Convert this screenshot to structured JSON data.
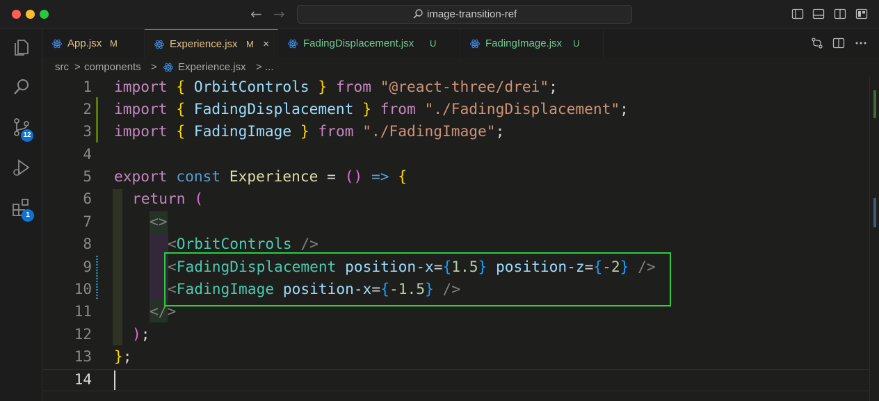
{
  "titlebar": {
    "search_text": "image-transition-ref"
  },
  "activity": {
    "source_control_badge": "12",
    "extensions_badge": "1"
  },
  "tabs": [
    {
      "label": "App.jsx",
      "status": "M",
      "color": "#e2c08d"
    },
    {
      "label": "Experience.jsx",
      "status": "M",
      "color": "#e2c08d"
    },
    {
      "label": "FadingDisplacement.jsx",
      "status": "U",
      "color": "#73c991"
    },
    {
      "label": "FadingImage.jsx",
      "status": "U",
      "color": "#73c991"
    }
  ],
  "close_glyph": "×",
  "breadcrumb": {
    "seg1": "src",
    "seg2": "components",
    "seg3": "Experience.jsx",
    "seg4": "...",
    "sep": ">"
  },
  "line_numbers": [
    "1",
    "2",
    "3",
    "4",
    "5",
    "6",
    "7",
    "8",
    "9",
    "10",
    "11",
    "12",
    "13",
    "14"
  ],
  "code": {
    "l1": {
      "t1": "import",
      "t2": " ",
      "t3": "{",
      "t4": " OrbitControls ",
      "t5": "}",
      "t6": " from ",
      "t7": "\"@react-three/drei\"",
      "t8": ";"
    },
    "l2": {
      "t1": "import",
      "t2": " ",
      "t3": "{",
      "t4": " FadingDisplacement ",
      "t5": "}",
      "t6": " from ",
      "t7": "\"./FadingDisplacement\"",
      "t8": ";"
    },
    "l3": {
      "t1": "import",
      "t2": " ",
      "t3": "{",
      "t4": " FadingImage ",
      "t5": "}",
      "t6": " from ",
      "t7": "\"./FadingImage\"",
      "t8": ";"
    },
    "l5": {
      "t1": "export",
      "t2": " ",
      "t3": "const",
      "t4": " ",
      "t5": "Experience",
      "t6": " = ",
      "t7": "()",
      "t8": " ",
      "t9": "=>",
      "t10": " ",
      "t11": "{"
    },
    "l6": {
      "t1": "return",
      "t2": " ",
      "t3": "("
    },
    "l7": {
      "t1": "<>"
    },
    "l8": {
      "t1": "<",
      "t2": "OrbitControls",
      "t3": " />"
    },
    "l9": {
      "t1": "<",
      "t2": "FadingDisplacement",
      "t3": " ",
      "t4": "position-x",
      "t5": "=",
      "t6": "{",
      "t7": "1.5",
      "t8": "}",
      "t9": " ",
      "t10": "position-z",
      "t11": "=",
      "t12": "{",
      "t13": "-2",
      "t14": "}",
      "t15": " />"
    },
    "l10": {
      "t1": "<",
      "t2": "FadingImage",
      "t3": " ",
      "t4": "position-x",
      "t5": "=",
      "t6": "{",
      "t7": "-1.5",
      "t8": "}",
      "t9": " />"
    },
    "l11": {
      "t1": "</>"
    },
    "l12": {
      "t1": ")",
      "t2": ";"
    },
    "l13": {
      "t1": "}",
      "t2": ";"
    }
  },
  "highlight_color": "#2ecc40"
}
